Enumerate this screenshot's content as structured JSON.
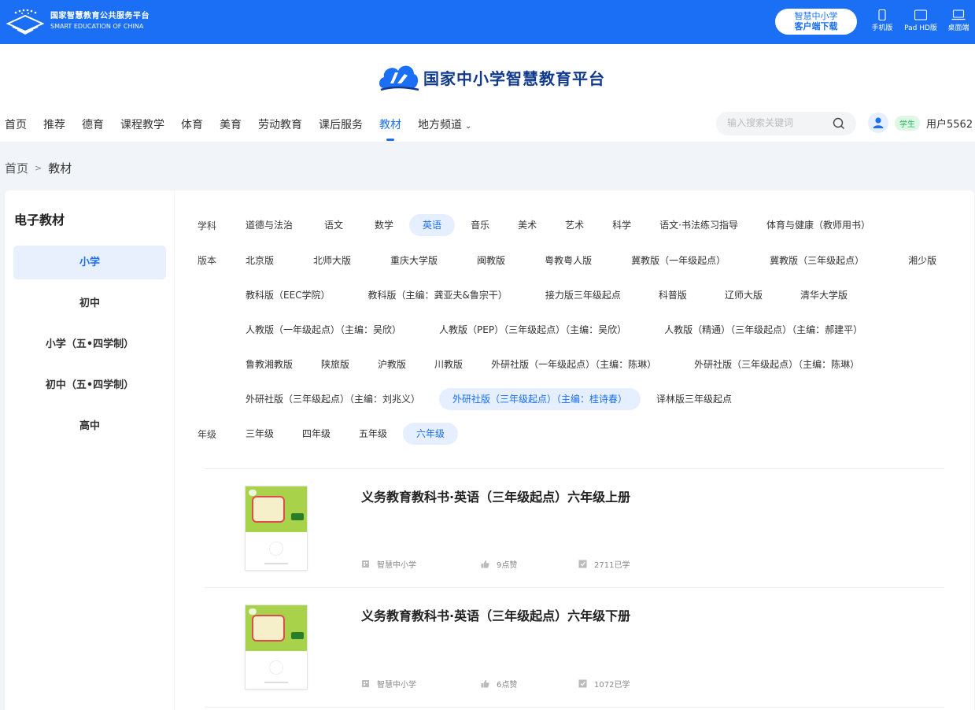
{
  "topbar": {
    "brand_cn": "国家智慧教育公共服务平台",
    "brand_en": "SMART EDUCATION OF CHINA",
    "download_line1": "智慧中小学",
    "download_line2": "客户端下载",
    "devices": [
      "手机版",
      "Pad HD版",
      "桌面端"
    ]
  },
  "header": {
    "site_title": "国家中小学智慧教育平台",
    "nav": [
      "首页",
      "推荐",
      "德育",
      "课程教学",
      "体育",
      "美育",
      "劳动教育",
      "课后服务",
      "教材",
      "地方频道"
    ],
    "nav_active": "教材",
    "search_placeholder": "输入搜索关键词",
    "user_role": "学生",
    "user_name": "用户5562"
  },
  "breadcrumb": {
    "home": "首页",
    "sep": ">",
    "current": "教材"
  },
  "sidebar": {
    "title": "电子教材",
    "items": [
      "小学",
      "初中",
      "小学（五•四学制）",
      "初中（五•四学制）",
      "高中"
    ],
    "active": "小学"
  },
  "filters": {
    "subject_label": "学科",
    "subjects": [
      "道德与法治",
      "语文",
      "数学",
      "英语",
      "音乐",
      "美术",
      "艺术",
      "科学",
      "语文·书法练习指导",
      "体育与健康（教师用书）"
    ],
    "subject_active": "英语",
    "edition_label": "版本",
    "editions": [
      [
        "北京版",
        "北师大版",
        "重庆大学版",
        "闽教版",
        "粤教粤人版",
        "冀教版（一年级起点）",
        "冀教版（三年级起点）",
        "湘少版"
      ],
      [
        "教科版（EEC学院）",
        "教科版（主编：龚亚夫&鲁宗干）",
        "接力版三年级起点",
        "科普版",
        "辽师大版",
        "清华大学版"
      ],
      [
        "人教版（一年级起点）（主编：吴欣）",
        "人教版（PEP）（三年级起点）（主编：吴欣）",
        "人教版（精通）（三年级起点）（主编：郝建平）"
      ],
      [
        "鲁教湘教版",
        "陕旅版",
        "沪教版",
        "川教版",
        "外研社版（一年级起点）（主编：陈琳）",
        "外研社版（三年级起点）（主编：陈琳）"
      ],
      [
        "外研社版（三年级起点）（主编：刘兆义）",
        "外研社版（三年级起点）（主编：桂诗春）",
        "译林版三年级起点"
      ]
    ],
    "edition_active": "外研社版（三年级起点）（主编：桂诗春）",
    "grade_label": "年级",
    "grades": [
      "三年级",
      "四年级",
      "五年级",
      "六年级"
    ],
    "grade_active": "六年级"
  },
  "books": [
    {
      "title": "义务教育教科书·英语（三年级起点）六年级上册",
      "publisher": "智慧中小学",
      "likes": "9点赞",
      "learners": "2711已学"
    },
    {
      "title": "义务教育教科书·英语（三年级起点）六年级下册",
      "publisher": "智慧中小学",
      "likes": "6点赞",
      "learners": "1072已学"
    }
  ],
  "colors": {
    "primary": "#1b6ff5",
    "active_bg": "#e6efff",
    "role_green": "#2bb458"
  }
}
